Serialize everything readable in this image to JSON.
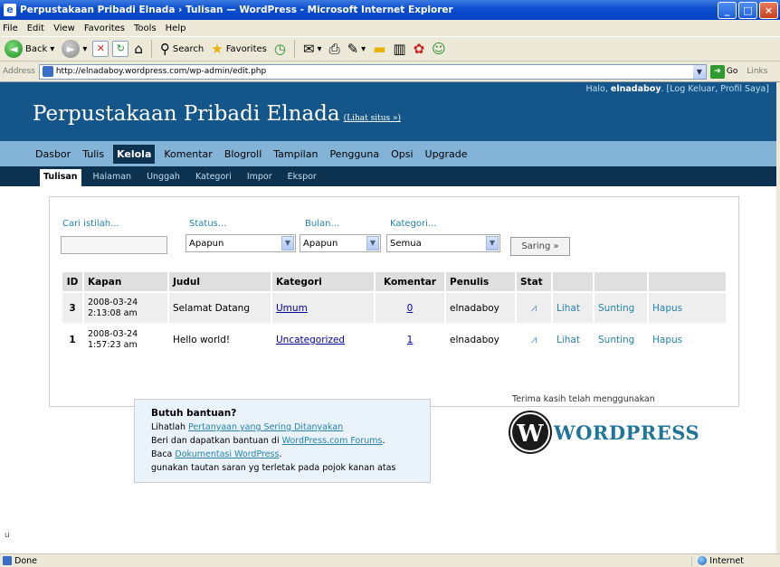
{
  "window": {
    "title": "Perpustakaan Pribadi Elnada › Tulisan — WordPress - Microsoft Internet Explorer",
    "controls": [
      "_",
      "□",
      "×"
    ]
  },
  "menu": [
    "File",
    "Edit",
    "View",
    "Favorites",
    "Tools",
    "Help"
  ],
  "toolbar": {
    "back": "Back",
    "search": "Search",
    "favorites": "Favorites"
  },
  "address": {
    "label": "Address",
    "url": "http://elnadaboy.wordpress.com/wp-admin/edit.php",
    "go": "Go",
    "links": "Links"
  },
  "wp": {
    "blog_title": "Perpustakaan Pribadi Elnada",
    "view_site": "(Lihat situs »)",
    "greeting": "Halo, ",
    "username": "elnadaboy",
    "user_links": ". [Log Keluar, Profil Saya]",
    "nav": [
      "Dasbor",
      "Tulis",
      "Kelola",
      "Komentar",
      "Blogroll",
      "Tampilan",
      "Pengguna",
      "Opsi",
      "Upgrade"
    ],
    "subnav": [
      "Tulisan",
      "Halaman",
      "Unggah",
      "Kategori",
      "Impor",
      "Ekspor"
    ]
  },
  "filters": {
    "search_label": "Cari istilah...",
    "search_value": "",
    "status_label": "Status...",
    "status_value": "Apapun",
    "month_label": "Bulan...",
    "month_value": "Apapun",
    "category_label": "Kategori...",
    "category_value": "Semua",
    "button": "Saring »"
  },
  "table": {
    "headers": [
      "ID",
      "Kapan",
      "Judul",
      "Kategori",
      "Komentar",
      "Penulis",
      "Stat",
      "",
      "",
      ""
    ],
    "rows": [
      {
        "id": "3",
        "date": "2008-03-24",
        "time": "2:13:08 am",
        "title": "Selamat Datang",
        "category": "Umum",
        "comments": "0",
        "author": "elnadaboy",
        "view": "Lihat",
        "edit": "Sunting",
        "delete": "Hapus"
      },
      {
        "id": "1",
        "date": "2008-03-24",
        "time": "1:57:23 am",
        "title": "Hello world!",
        "category": "Uncategorized",
        "comments": "1",
        "author": "elnadaboy",
        "view": "Lihat",
        "edit": "Sunting",
        "delete": "Hapus"
      }
    ]
  },
  "help": {
    "title": "Butuh bantuan?",
    "line1_prefix": "Lihatlah ",
    "line1_link": "Pertanyaan yang Sering Ditanyakan",
    "line2_prefix": "Beri dan dapatkan bantuan di ",
    "line2_link": "WordPress.com Forums",
    "line2_suffix": ".",
    "line3_prefix": "Baca ",
    "line3_link": "Dokumentasi WordPress",
    "line3_suffix": ".",
    "line4": "gunakan tautan saran yg terletak pada pojok kanan atas"
  },
  "footer": {
    "thanks": "Terima kasih telah menggunakan",
    "logo_mark": "W",
    "logo_word": "WORDPRESS"
  },
  "left_note": "u",
  "status": {
    "text": "Done",
    "zone": "Internet"
  },
  "colors": {
    "header": "#14568a",
    "nav": "#83b4d8",
    "subnav": "#0d324f",
    "link": "#2583ad"
  }
}
